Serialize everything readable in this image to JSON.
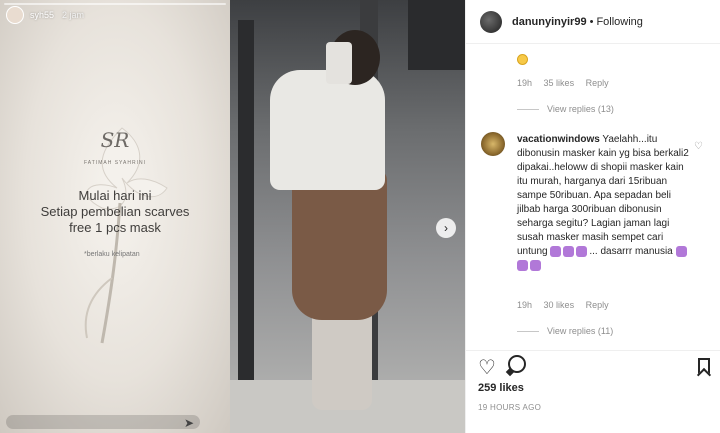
{
  "story": {
    "username": "syh55",
    "time": "2 jam",
    "brand_initials": "SR",
    "brand_name": "FATIMAH SYAHRINI",
    "promo_line1": "Mulai hari ini",
    "promo_line2": "Setiap pembelian scarves",
    "promo_line3": "free 1  pcs mask",
    "promo_note": "*berlaku kelipatan"
  },
  "post": {
    "author": "danunyinyir99",
    "separator": "•",
    "follow_status": "Following",
    "next_icon": "chevron-right-icon",
    "comments": [
      {
        "tail_text": "",
        "age": "19h",
        "likes": "35 likes",
        "reply": "Reply",
        "view_replies": "View replies (13)"
      },
      {
        "username": "vacationwindows",
        "text": "Yaelahh...itu dibonusin masker kain yg bisa berkali2 dipakai..heloww di shopii masker kain itu murah, harganya dari 15ribuan sampe 50ribuan. Apa sepadan beli jilbab harga 300ribuan dibonusin seharga segitu? Lagian jaman lagi susah masker masih sempet cari untung",
        "ellipsis": "... dasarrr manusia",
        "age": "19h",
        "likes": "30 likes",
        "reply": "Reply",
        "view_replies": "View replies (11)"
      }
    ],
    "likes": "259 likes",
    "posted": "19 HOURS AGO"
  },
  "colors": {
    "text": "#262626",
    "muted": "#8e8e8e",
    "border": "#efefef"
  }
}
